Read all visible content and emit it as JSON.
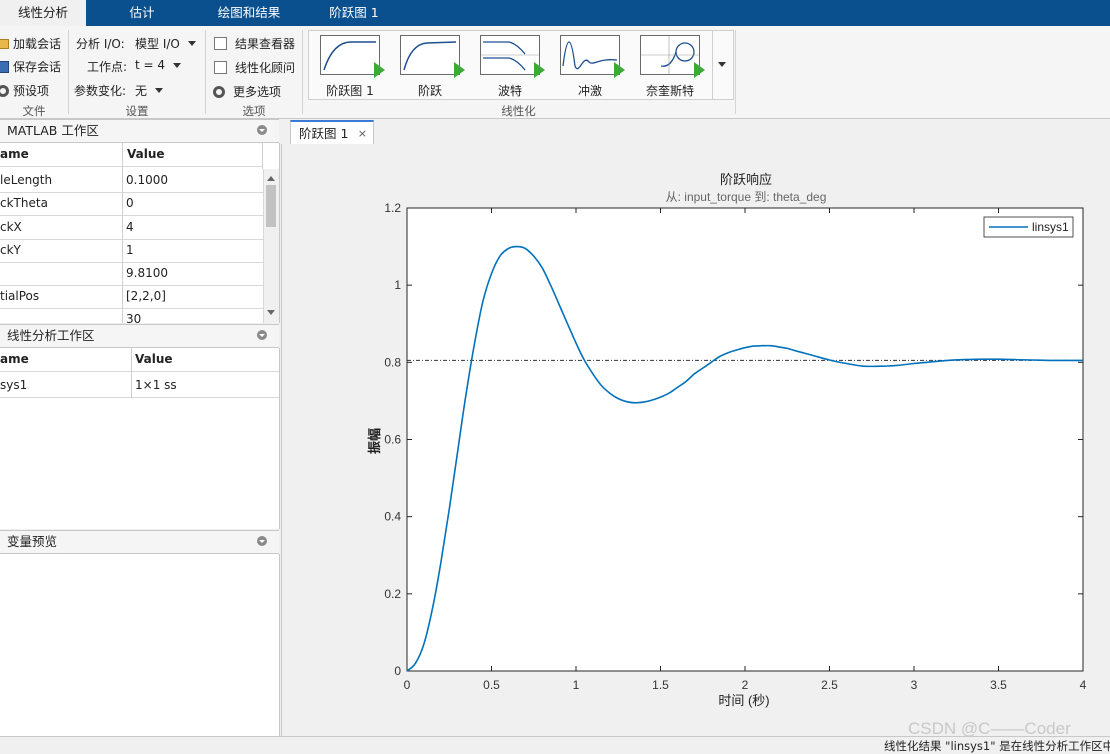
{
  "top_tabs": [
    "线性分析",
    "估计",
    "绘图和结果",
    "阶跃图 1"
  ],
  "ribbon": {
    "file": {
      "title": "文件",
      "load": "加载会话",
      "save": "保存会话",
      "prefs": "预设项"
    },
    "settings": {
      "title": "设置",
      "io_label": "分析 I/O:",
      "io_value": "模型 I/O",
      "op_label": "工作点:",
      "op_value": "t = 4",
      "param_label": "参数变化:",
      "param_value": "无"
    },
    "options": {
      "title": "选项",
      "result_viewer": "结果查看器",
      "advisor": "线性化顾问",
      "more": "更多选项"
    },
    "linearize": {
      "title": "线性化",
      "items": [
        "阶跃图 1",
        "阶跃",
        "波特",
        "冲激",
        "奈奎斯特"
      ]
    }
  },
  "matlab_ws": {
    "title": "MATLAB 工作区",
    "headers": [
      "ame",
      "Value"
    ],
    "rows": [
      [
        "leLength",
        "0.1000"
      ],
      [
        "ckTheta",
        "0"
      ],
      [
        "ckX",
        "4"
      ],
      [
        "ckY",
        "1"
      ],
      [
        "",
        "9.8100"
      ],
      [
        "tialPos",
        "[2,2,0]"
      ],
      [
        "",
        "30"
      ]
    ]
  },
  "lin_ws": {
    "title": "线性分析工作区",
    "headers": [
      "ame",
      "Value"
    ],
    "rows": [
      [
        "sys1",
        "1×1 ss"
      ]
    ]
  },
  "var_preview": {
    "title": "变量预览"
  },
  "doc_tab": {
    "label": "阶跃图 1",
    "close": "×"
  },
  "chart_data": {
    "type": "line",
    "title": "阶跃响应",
    "subtitle": "从: input_torque  到: theta_deg",
    "xlabel": "时间 (秒)",
    "ylabel": "振幅",
    "xlim": [
      0,
      4
    ],
    "ylim": [
      0,
      1.2
    ],
    "xticks": [
      "0",
      "0.5",
      "1",
      "1.5",
      "2",
      "2.5",
      "3",
      "3.5",
      "4"
    ],
    "yticks": [
      "0",
      "0.2",
      "0.4",
      "0.6",
      "0.8",
      "1",
      "1.2"
    ],
    "legend": "top-right",
    "grid": false,
    "steady_state": 0.805,
    "series": [
      {
        "name": "linsys1",
        "color": "#0072bd",
        "x": [
          0,
          0.05,
          0.1,
          0.15,
          0.2,
          0.25,
          0.3,
          0.35,
          0.4,
          0.45,
          0.5,
          0.55,
          0.6,
          0.65,
          0.7,
          0.75,
          0.8,
          0.85,
          0.9,
          0.95,
          1.0,
          1.05,
          1.1,
          1.15,
          1.2,
          1.25,
          1.3,
          1.35,
          1.4,
          1.45,
          1.5,
          1.55,
          1.6,
          1.65,
          1.7,
          1.75,
          1.8,
          1.85,
          1.9,
          1.95,
          2.0,
          2.05,
          2.1,
          2.15,
          2.2,
          2.25,
          2.3,
          2.35,
          2.4,
          2.5,
          2.6,
          2.7,
          2.8,
          2.9,
          3.0,
          3.1,
          3.2,
          3.3,
          3.4,
          3.5,
          3.6,
          3.7,
          3.8,
          3.9,
          4.0
        ],
        "y": [
          0,
          0.02,
          0.07,
          0.16,
          0.28,
          0.42,
          0.57,
          0.72,
          0.85,
          0.96,
          1.03,
          1.075,
          1.095,
          1.1,
          1.095,
          1.075,
          1.045,
          1.0,
          0.95,
          0.9,
          0.85,
          0.805,
          0.77,
          0.74,
          0.72,
          0.706,
          0.698,
          0.695,
          0.697,
          0.702,
          0.71,
          0.72,
          0.735,
          0.75,
          0.77,
          0.785,
          0.8,
          0.815,
          0.825,
          0.832,
          0.838,
          0.842,
          0.843,
          0.843,
          0.84,
          0.836,
          0.83,
          0.824,
          0.818,
          0.806,
          0.797,
          0.79,
          0.79,
          0.792,
          0.797,
          0.801,
          0.805,
          0.807,
          0.808,
          0.808,
          0.807,
          0.806,
          0.805,
          0.805,
          0.805
        ]
      }
    ]
  },
  "status": "线性化结果 \"linsys1\" 是在线性分析工作区中",
  "watermark": "CSDN @C——Coder"
}
